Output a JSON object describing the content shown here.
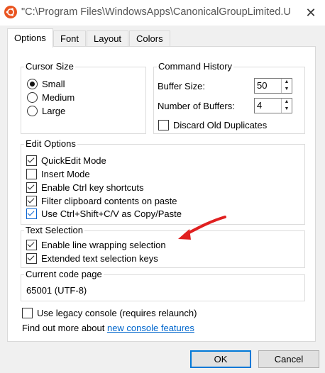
{
  "window": {
    "title": "\"C:\\Program Files\\WindowsApps\\CanonicalGroupLimited.Ub...",
    "app_icon": "ubuntu-logo-icon",
    "close_glyph": "✕"
  },
  "tabs": [
    {
      "label": "Options",
      "active": true
    },
    {
      "label": "Font",
      "active": false
    },
    {
      "label": "Layout",
      "active": false
    },
    {
      "label": "Colors",
      "active": false
    }
  ],
  "cursor_size": {
    "title": "Cursor Size",
    "options": [
      {
        "label": "Small",
        "selected": true
      },
      {
        "label": "Medium",
        "selected": false
      },
      {
        "label": "Large",
        "selected": false
      }
    ]
  },
  "command_history": {
    "title": "Command History",
    "buffer_size_label": "Buffer Size:",
    "buffer_size_value": "50",
    "num_buffers_label": "Number of Buffers:",
    "num_buffers_value": "4",
    "discard_label": "Discard Old Duplicates",
    "discard_checked": false
  },
  "edit_options": {
    "title": "Edit Options",
    "items": [
      {
        "label": "QuickEdit Mode",
        "checked": true
      },
      {
        "label": "Insert Mode",
        "checked": false
      },
      {
        "label": "Enable Ctrl key shortcuts",
        "checked": true
      },
      {
        "label": "Filter clipboard contents on paste",
        "checked": true
      },
      {
        "label": "Use Ctrl+Shift+C/V as Copy/Paste",
        "checked": true
      }
    ]
  },
  "text_selection": {
    "title": "Text Selection",
    "items": [
      {
        "label": "Enable line wrapping selection",
        "checked": true
      },
      {
        "label": "Extended text selection keys",
        "checked": true
      }
    ]
  },
  "code_page": {
    "title": "Current code page",
    "value": "65001 (UTF-8)"
  },
  "legacy": {
    "label": "Use legacy console (requires relaunch)",
    "checked": false
  },
  "find_out": {
    "text": "Find out more about ",
    "link": "new console features"
  },
  "buttons": {
    "ok": "OK",
    "cancel": "Cancel"
  },
  "annotation": {
    "arrow_color": "#e02020"
  }
}
